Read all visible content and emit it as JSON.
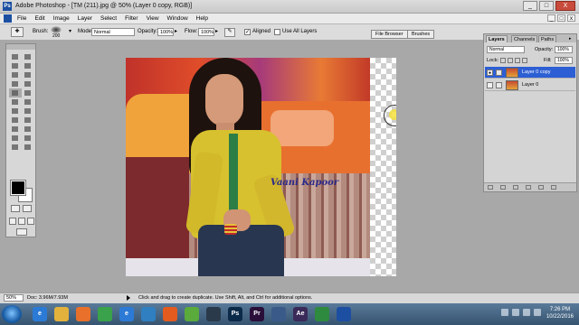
{
  "window": {
    "title": "Adobe Photoshop - [TM (211).jpg @ 50% (Layer 0 copy, RGB)]",
    "app_icon": "Ps",
    "controls": [
      "_",
      "□",
      "X"
    ]
  },
  "menubar": {
    "items": [
      "File",
      "Edit",
      "Image",
      "Layer",
      "Select",
      "Filter",
      "View",
      "Window",
      "Help"
    ],
    "doc_controls": [
      "_",
      "□",
      "x"
    ]
  },
  "options": {
    "brush_label": "Brush:",
    "brush_size": "200",
    "mode_label": "Mode:",
    "mode_value": "Normal",
    "opacity_label": "Opacity:",
    "opacity_value": "100%",
    "flow_label": "Flow:",
    "flow_value": "100%",
    "aligned_label": "Aligned",
    "aligned_checked": "✓",
    "use_all_layers_label": "Use All Layers",
    "tabs": [
      "File Browser",
      "Brushes"
    ]
  },
  "document": {
    "watermark": "Vaani Kapoor"
  },
  "layers_panel": {
    "tabs": [
      "Layers",
      "Channels",
      "Paths"
    ],
    "blend_mode": "Normal",
    "opacity_label": "Opacity:",
    "opacity_value": "100%",
    "lock_label": "Lock:",
    "fill_label": "Fill:",
    "fill_value": "100%",
    "layers": [
      {
        "name": "Layer 0 copy",
        "visible": "●",
        "selected": true
      },
      {
        "name": "Layer 0",
        "visible": "",
        "selected": false
      }
    ]
  },
  "statusbar": {
    "zoom": "50%",
    "doc": "Doc: 3.96M/7.93M",
    "hint": "Click and drag to create duplicate. Use Shift, Alt, and Ctrl for additional options."
  },
  "taskbar": {
    "apps": [
      {
        "name": "ie",
        "label": "e",
        "color": "#2b7bd6"
      },
      {
        "name": "folder",
        "label": "",
        "color": "#e3b23c"
      },
      {
        "name": "firefox",
        "label": "",
        "color": "#e8702a"
      },
      {
        "name": "chrome",
        "label": "",
        "color": "#3aa24a"
      },
      {
        "name": "edge",
        "label": "e",
        "color": "#2c7ad6"
      },
      {
        "name": "media",
        "label": "",
        "color": "#2f7fc1"
      },
      {
        "name": "app-orange",
        "label": "",
        "color": "#e35b1f"
      },
      {
        "name": "app-green",
        "label": "",
        "color": "#5aaa3c"
      },
      {
        "name": "steam",
        "label": "",
        "color": "#2a3a4a"
      },
      {
        "name": "photoshop",
        "label": "Ps",
        "color": "#0b2a4a"
      },
      {
        "name": "premiere",
        "label": "Pr",
        "color": "#2a0f3a"
      },
      {
        "name": "app-blue",
        "label": "",
        "color": "#3a5a8a"
      },
      {
        "name": "after-effects",
        "label": "Ae",
        "color": "#3a2a5a"
      },
      {
        "name": "app-flag",
        "label": "",
        "color": "#2e8a3e"
      },
      {
        "name": "photoshop-legacy",
        "label": "",
        "color": "#1c4fa1"
      }
    ],
    "time": "7:26 PM",
    "date": "10/22/2016"
  }
}
